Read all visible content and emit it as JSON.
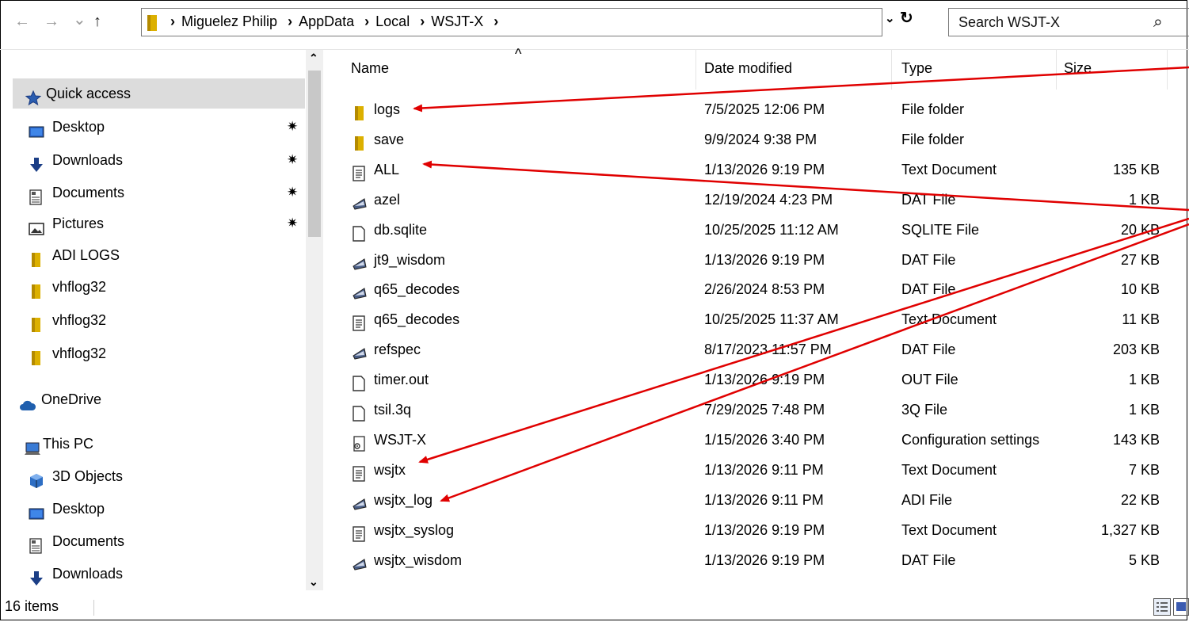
{
  "nav": {
    "back": "←",
    "forward": "→",
    "recent": "⌄",
    "up": "↑"
  },
  "address": {
    "crumbs": [
      "Miguelez Philip",
      "AppData",
      "Local",
      "WSJT-X"
    ],
    "separator": "›",
    "dropdown": "⌄",
    "refresh": "↻"
  },
  "search": {
    "placeholder": "Search WSJT-X",
    "icon": "search-icon"
  },
  "sidebar": {
    "items": [
      {
        "label": "Quick access",
        "icon": "star-icon",
        "selected": true,
        "pinned": false
      },
      {
        "label": "Desktop",
        "icon": "desktop-icon",
        "pinned": true
      },
      {
        "label": "Downloads",
        "icon": "download-arrow-icon",
        "pinned": true
      },
      {
        "label": "Documents",
        "icon": "documents-icon",
        "pinned": true
      },
      {
        "label": "Pictures",
        "icon": "pictures-icon",
        "pinned": true
      },
      {
        "label": "ADI LOGS",
        "icon": "folder-icon",
        "pinned": false
      },
      {
        "label": "vhflog32",
        "icon": "folder-icon",
        "pinned": false
      },
      {
        "label": "vhflog32",
        "icon": "folder-icon",
        "pinned": false
      },
      {
        "label": "vhflog32",
        "icon": "folder-icon",
        "pinned": false
      },
      {
        "label": "OneDrive",
        "icon": "cloud-icon",
        "pinned": false
      },
      {
        "label": "This PC",
        "icon": "computer-icon",
        "pinned": false
      },
      {
        "label": "3D Objects",
        "icon": "cube-icon",
        "pinned": false
      },
      {
        "label": "Desktop",
        "icon": "desktop-icon",
        "pinned": false
      },
      {
        "label": "Documents",
        "icon": "documents-icon",
        "pinned": false
      },
      {
        "label": "Downloads",
        "icon": "download-arrow-icon",
        "pinned": false
      }
    ]
  },
  "columns": {
    "name": "Name",
    "date": "Date modified",
    "type": "Type",
    "size": "Size",
    "sort_indicator": "^"
  },
  "files": [
    {
      "name": "logs",
      "date": "7/5/2025 12:06 PM",
      "type": "File folder",
      "size": "",
      "icon": "folder-icon"
    },
    {
      "name": "save",
      "date": "9/9/2024 9:38 PM",
      "type": "File folder",
      "size": "",
      "icon": "folder-icon"
    },
    {
      "name": "ALL",
      "date": "1/13/2026 9:19 PM",
      "type": "Text Document",
      "size": "135 KB",
      "icon": "text-document-icon"
    },
    {
      "name": "azel",
      "date": "12/19/2024 4:23 PM",
      "type": "DAT File",
      "size": "1 KB",
      "icon": "dat-file-icon"
    },
    {
      "name": "db.sqlite",
      "date": "10/25/2025 11:12 AM",
      "type": "SQLITE File",
      "size": "20 KB",
      "icon": "blank-file-icon"
    },
    {
      "name": "jt9_wisdom",
      "date": "1/13/2026 9:19 PM",
      "type": "DAT File",
      "size": "27 KB",
      "icon": "dat-file-icon"
    },
    {
      "name": "q65_decodes",
      "date": "2/26/2024 8:53 PM",
      "type": "DAT File",
      "size": "10 KB",
      "icon": "dat-file-icon"
    },
    {
      "name": "q65_decodes",
      "date": "10/25/2025 11:37 AM",
      "type": "Text Document",
      "size": "11 KB",
      "icon": "text-document-icon"
    },
    {
      "name": "refspec",
      "date": "8/17/2023 11:57 PM",
      "type": "DAT File",
      "size": "203 KB",
      "icon": "dat-file-icon"
    },
    {
      "name": "timer.out",
      "date": "1/13/2026 9:19 PM",
      "type": "OUT File",
      "size": "1 KB",
      "icon": "blank-file-icon"
    },
    {
      "name": "tsil.3q",
      "date": "7/29/2025 7:48 PM",
      "type": "3Q File",
      "size": "1 KB",
      "icon": "blank-file-icon"
    },
    {
      "name": "WSJT-X",
      "date": "1/15/2026 3:40 PM",
      "type": "Configuration settings",
      "size": "143 KB",
      "icon": "config-file-icon"
    },
    {
      "name": "wsjtx",
      "date": "1/13/2026 9:11 PM",
      "type": "Text Document",
      "size": "7 KB",
      "icon": "text-document-icon"
    },
    {
      "name": "wsjtx_log",
      "date": "1/13/2026 9:11 PM",
      "type": "ADI File",
      "size": "22 KB",
      "icon": "dat-file-icon"
    },
    {
      "name": "wsjtx_syslog",
      "date": "1/13/2026 9:19 PM",
      "type": "Text Document",
      "size": "1,327 KB",
      "icon": "text-document-icon"
    },
    {
      "name": "wsjtx_wisdom",
      "date": "1/13/2026 9:19 PM",
      "type": "DAT File",
      "size": "5 KB",
      "icon": "dat-file-icon"
    }
  ],
  "status": {
    "count": "16 items"
  },
  "colors": {
    "folder": "#dcb000",
    "annotation": "#e00000",
    "selection": "#dcdcdc"
  }
}
